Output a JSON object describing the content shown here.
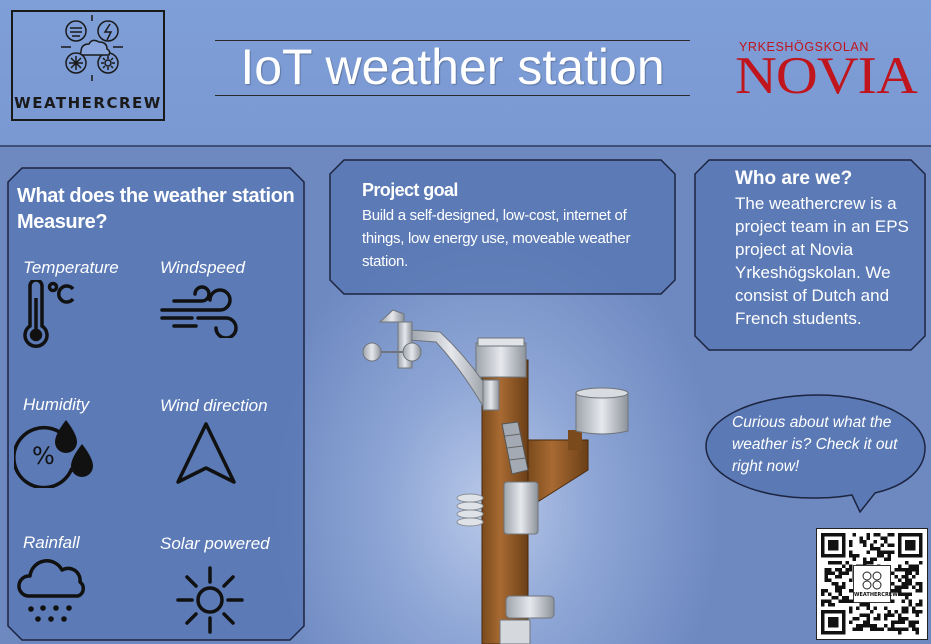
{
  "header": {
    "logo_text": "WEATHERCREW",
    "title": "IoT weather station",
    "school_small": "YRKESHÖGSKOLAN",
    "school_big": "NOVIA"
  },
  "measure": {
    "title": "What does the weather station Measure?",
    "items": [
      {
        "label": "Temperature",
        "icon": "thermometer-icon"
      },
      {
        "label": "Windspeed",
        "icon": "wind-icon"
      },
      {
        "label": "Humidity",
        "icon": "humidity-icon"
      },
      {
        "label": "Wind direction",
        "icon": "navigation-arrow-icon"
      },
      {
        "label": "Rainfall",
        "icon": "rain-cloud-icon"
      },
      {
        "label": "Solar powered",
        "icon": "sun-icon"
      }
    ]
  },
  "goal": {
    "title": "Project goal",
    "text": "Build a self-designed, low-cost, internet of things, low energy use, moveable weather station."
  },
  "who": {
    "title": "Who are we?",
    "text": "The weathercrew is a project team in an EPS project at Novia Yrkeshögskolan. We consist of Dutch and French students."
  },
  "callout": {
    "text": "Curious about what the weather is? Check it out right now!"
  },
  "qr": {
    "caption": "WEATHERCREW"
  }
}
